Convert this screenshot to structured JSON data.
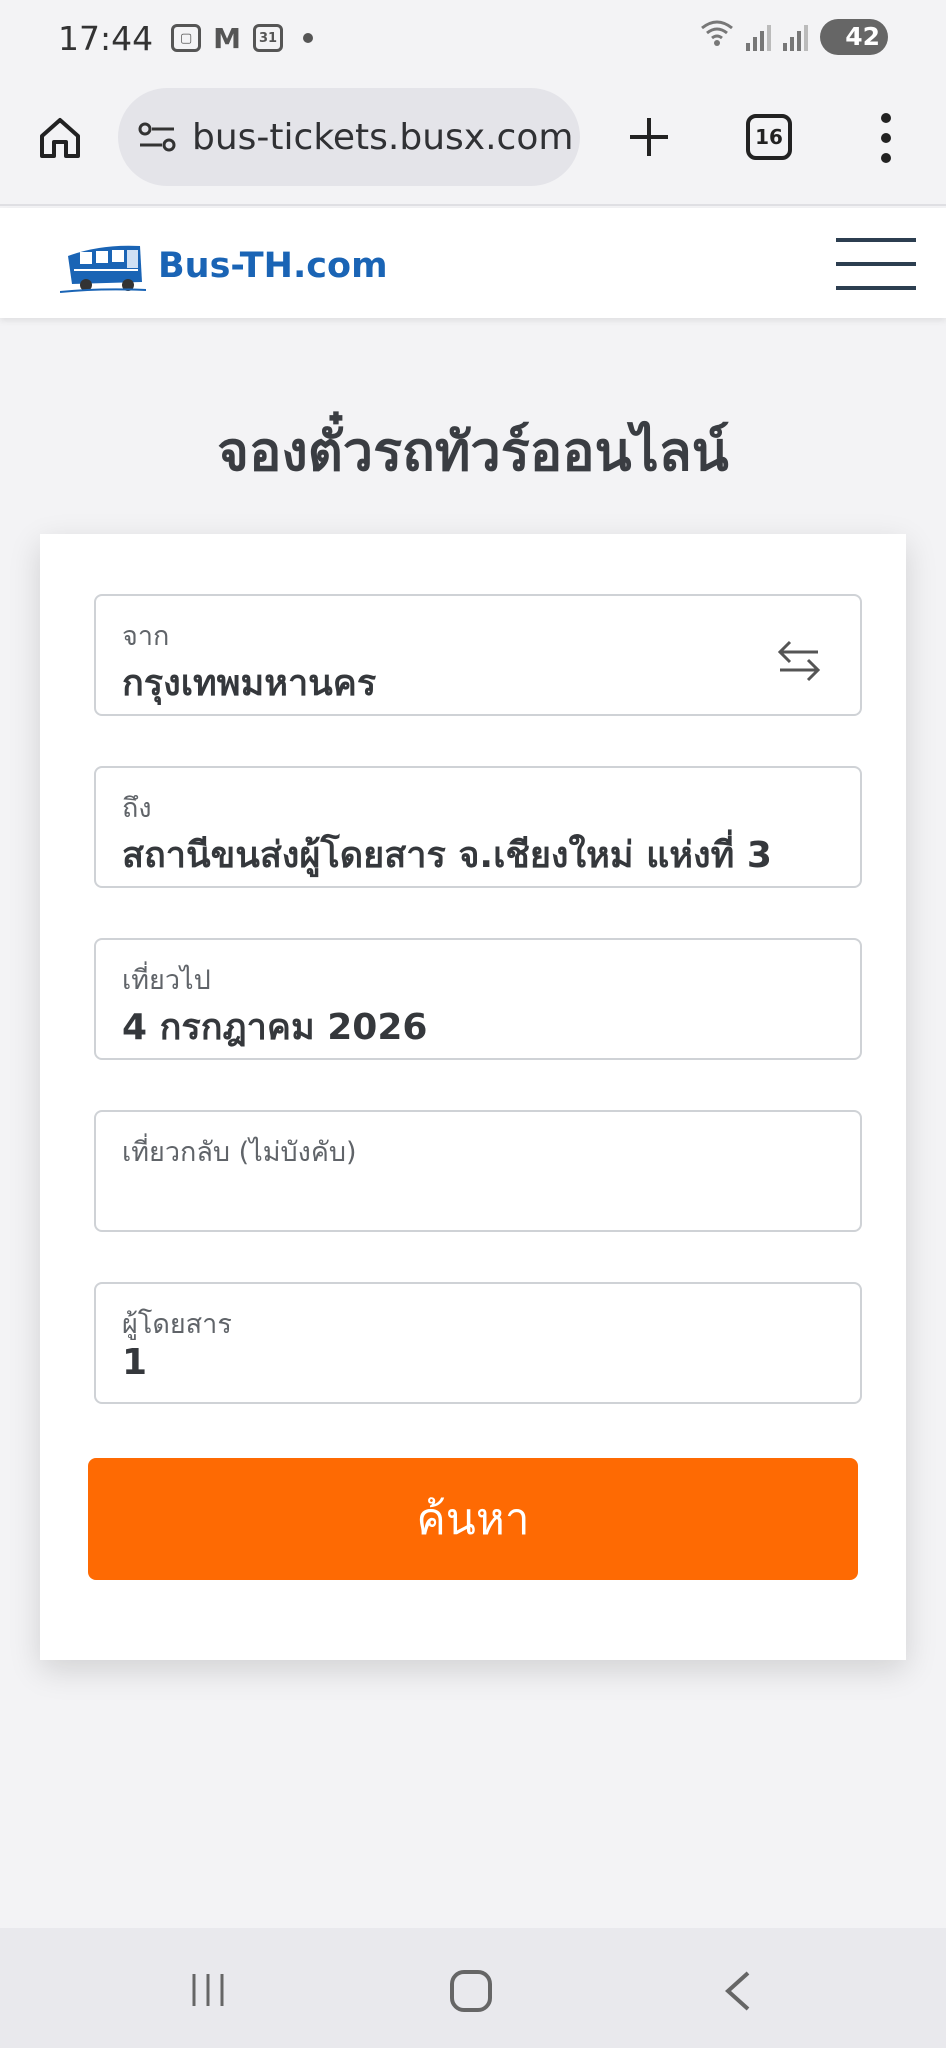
{
  "status_bar": {
    "time": "17:44",
    "battery": "42",
    "calendar_day": "31"
  },
  "browser": {
    "url": "bus-tickets.busx.com",
    "tab_count": "16"
  },
  "site": {
    "brand": "Bus-TH.com"
  },
  "page": {
    "title": "จองตั๋วรถทัวร์ออนไลน์"
  },
  "form": {
    "from_label": "จาก",
    "from_value": "กรุงเทพมหานคร",
    "to_label": "ถึง",
    "to_value": "สถานีขนส่งผู้โดยสาร จ.เชียงใหม่ แห่งที่ 3",
    "depart_label": "เที่ยวไป",
    "depart_value": "4 กรกฎาคม 2026",
    "return_label": "เที่ยวกลับ (ไม่บังคับ)",
    "return_value": "",
    "passengers_label": "ผู้โดยสาร",
    "passengers_value": "1",
    "search_label": "ค้นหา"
  },
  "colors": {
    "accent": "#fe6a03",
    "brand": "#1a64b5"
  },
  "icons": {
    "home": "home-icon",
    "site_settings": "tune-icon",
    "new_tab": "plus-icon",
    "tabs": "tabs-icon",
    "menu": "more-vert-icon",
    "swap": "swap-icon",
    "hamburger": "menu-icon"
  }
}
